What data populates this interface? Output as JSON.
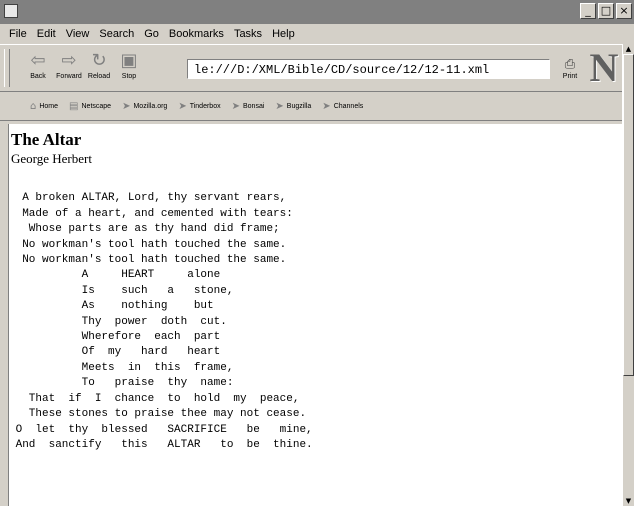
{
  "window": {
    "buttons": {
      "minimize": "_",
      "maximize": "□",
      "close": "×"
    }
  },
  "menu": [
    "File",
    "Edit",
    "View",
    "Search",
    "Go",
    "Bookmarks",
    "Tasks",
    "Help"
  ],
  "toolbar": {
    "back_label": "Back",
    "forward_label": "Forward",
    "reload_label": "Reload",
    "stop_label": "Stop",
    "print_label": "Print",
    "url": "le:///D:/XML/Bible/CD/source/12/12-11.xml",
    "logo": "N"
  },
  "personal_bar": [
    "Home",
    "Netscape",
    "Mozilla.org",
    "Tinderbox",
    "Bonsai",
    "Bugzilla",
    "Channels"
  ],
  "page": {
    "title": "The Altar",
    "author": "George Herbert",
    "poem_lines": [
      "  A broken ALTAR, Lord, thy servant rears,",
      "  Made of a heart, and cemented with tears:",
      "   Whose parts are as thy hand did frame;",
      "  No workman's tool hath touched the same.",
      "  No workman's tool hath touched the same.",
      "           A     HEART     alone",
      "           Is    such   a   stone,",
      "           As    nothing    but",
      "           Thy  power  doth  cut.",
      "           Wherefore  each  part",
      "           Of  my   hard   heart",
      "           Meets  in  this  frame,",
      "           To   praise  thy  name:",
      "   That  if  I  chance  to  hold  my  peace,",
      "   These stones to praise thee may not cease.",
      " O  let  thy  blessed   SACRIFICE   be   mine,",
      " And  sanctify   this   ALTAR   to  be  thine."
    ]
  },
  "colors": {
    "chrome": "#d4d0c8",
    "titlebar": "#808080",
    "content_bg": "#ffffff"
  }
}
